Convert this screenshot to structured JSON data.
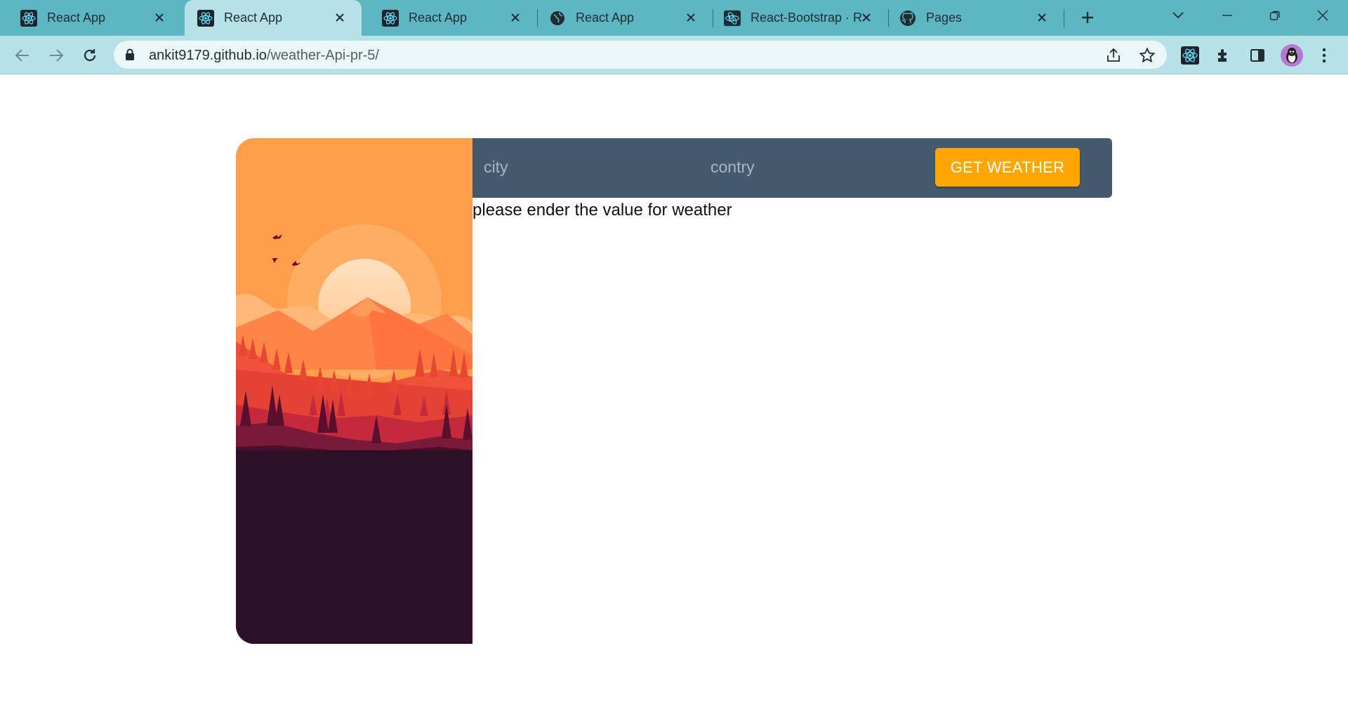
{
  "browser": {
    "tabs": [
      {
        "title": "React App",
        "favicon": "react-icon",
        "active": false
      },
      {
        "title": "React App",
        "favicon": "react-icon",
        "active": true
      },
      {
        "title": "React App",
        "favicon": "react-icon",
        "active": false
      },
      {
        "title": "React App",
        "favicon": "globe-icon",
        "active": false
      },
      {
        "title": "React-Bootstrap · R",
        "favicon": "react-bootstrap-icon",
        "active": false
      },
      {
        "title": "Pages",
        "favicon": "github-icon",
        "active": false
      }
    ],
    "url_host": "ankit9179.github.io",
    "url_path": "/weather-Api-pr-5/"
  },
  "app": {
    "city_placeholder": "city",
    "country_placeholder": "contry",
    "button_label": "GET WEATHER",
    "message": "please ender the value for weather"
  },
  "colors": {
    "tabstrip": "#5cb7c3",
    "toolbar": "#b6e1e6",
    "form_bar": "#455a6e",
    "button": "#ffa600",
    "sky": "#ff9e4a",
    "ground": "#2c1027"
  }
}
